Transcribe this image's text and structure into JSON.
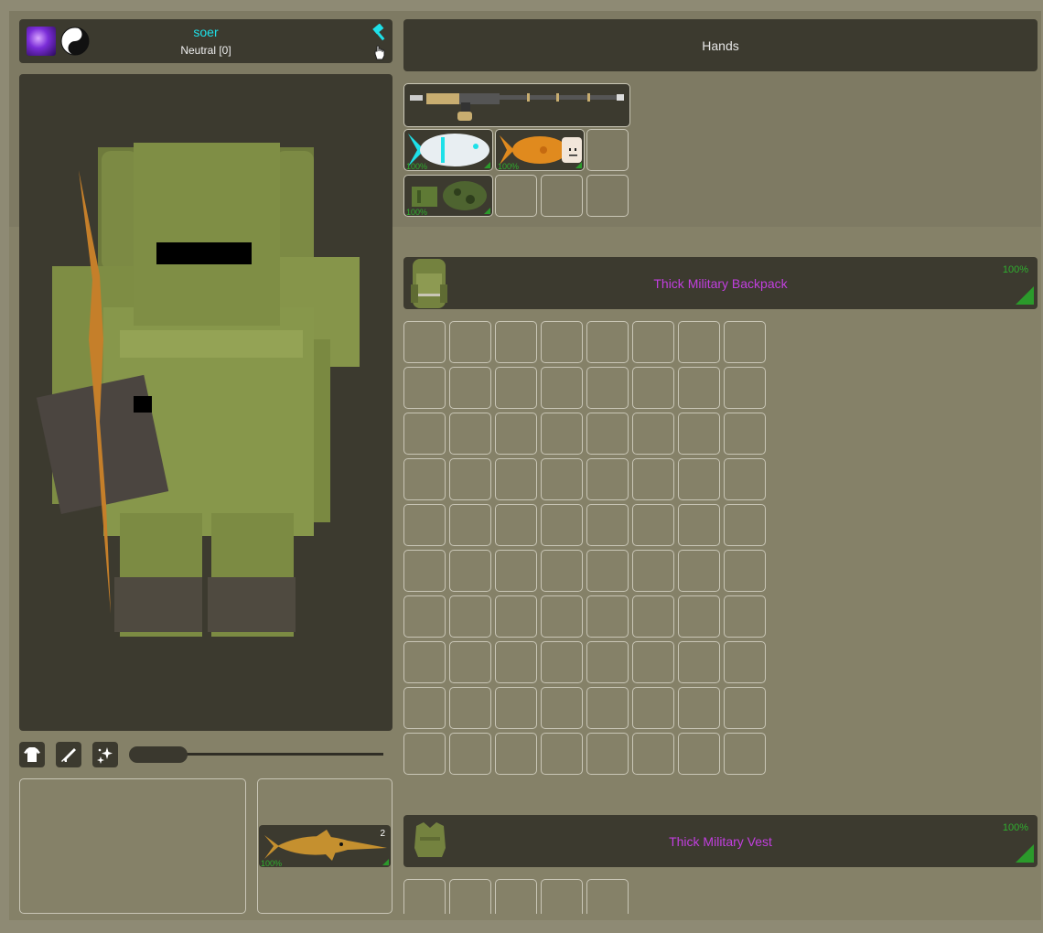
{
  "player": {
    "name": "soer",
    "reputation": "Neutral [0]",
    "icons": [
      "void-skill-icon",
      "yin-yang-icon",
      "hammer-icon",
      "hand-cursor-icon"
    ]
  },
  "hands": {
    "title": "Hands"
  },
  "hand_items": [
    {
      "name": "sniper-rifle",
      "percent": ""
    },
    {
      "name": "fish-white",
      "percent": "100%"
    },
    {
      "name": "fish-orange",
      "percent": "100%"
    },
    {
      "name": "green-crafting-item",
      "percent": "100%"
    }
  ],
  "backpack": {
    "title": "Thick Military Backpack",
    "percent": "100%",
    "rows": 10,
    "cols": 8
  },
  "vest": {
    "title": "Thick Military Vest",
    "percent": "100%"
  },
  "toolbar": {
    "icons": [
      "shirt-icon",
      "rifle-icon",
      "sparkle-icon"
    ],
    "slider_value": 0.23
  },
  "equip_slot": {
    "item": "swordfish",
    "count": "2",
    "percent": "100%"
  },
  "colors": {
    "name": "#1ee0e8",
    "item_title": "#c23fdf",
    "percent": "#2fae2f",
    "panel": "#3c3a2f",
    "slot_border": "#c9c6b6"
  }
}
